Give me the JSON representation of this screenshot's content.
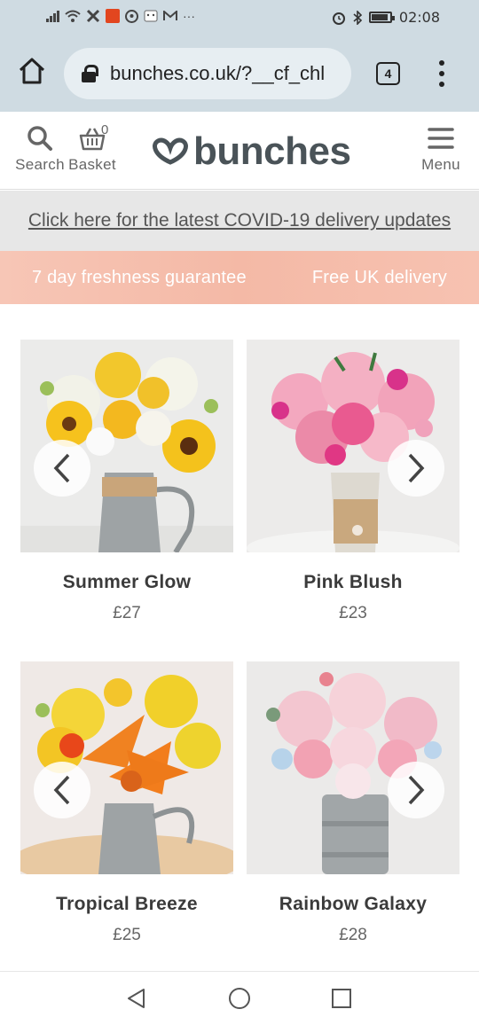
{
  "status_bar": {
    "time": "02:08",
    "notification_icons": [
      "signal-icon",
      "wifi-icon",
      "tools-icon",
      "app-notification-icon",
      "pinterest-icon",
      "face-icon",
      "gmail-icon",
      "more-dots-icon"
    ],
    "more": "···"
  },
  "browser": {
    "url": "bunches.co.uk/?__cf_chl",
    "tab_count": "4"
  },
  "header": {
    "search_label": "Search",
    "basket_label": "Basket",
    "basket_count": "0",
    "logo_text": "bunches",
    "menu_label": "Menu"
  },
  "covid_link": "Click here for the latest COVID-19 delivery updates",
  "promo": {
    "left": "7 day freshness guarantee",
    "right": "Free UK delivery"
  },
  "products": [
    {
      "name": "Summer Glow",
      "price": "£27"
    },
    {
      "name": "Pink Blush",
      "price": "£23"
    },
    {
      "name": "Tropical Breeze",
      "price": "£25"
    },
    {
      "name": "Rainbow Galaxy",
      "price": "£28"
    }
  ],
  "colors": {
    "browser_chrome": "#cfdbe2",
    "logo": "#4a5358",
    "promo_banner": "#f4b9a6"
  }
}
